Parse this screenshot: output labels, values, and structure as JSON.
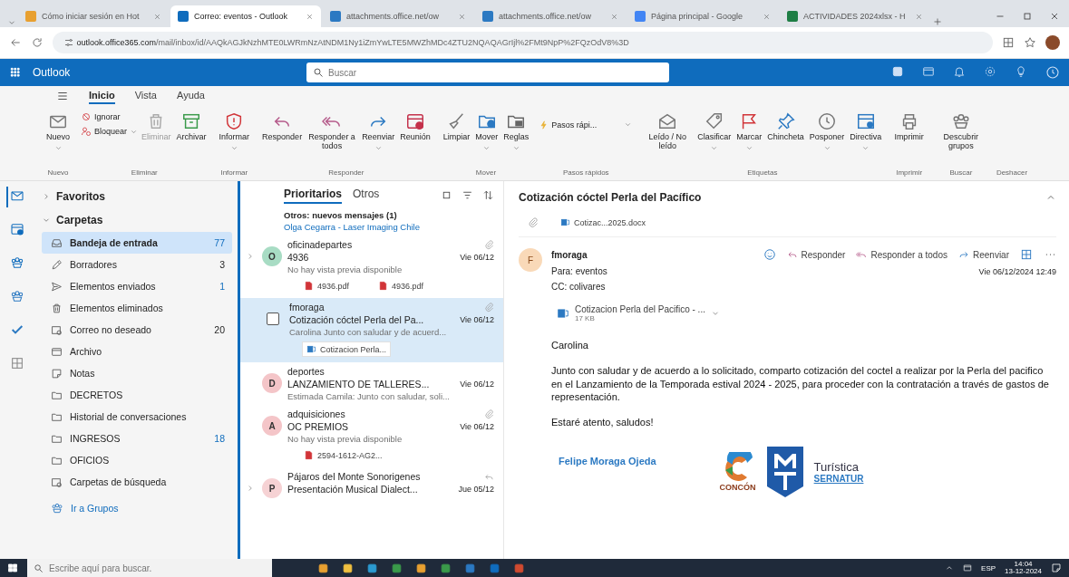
{
  "browser": {
    "tabs": [
      {
        "title": "Cómo iniciar sesión en Hot",
        "selected": false
      },
      {
        "title": "Correo: eventos - Outlook",
        "selected": true
      },
      {
        "title": "attachments.office.net/ow",
        "selected": false
      },
      {
        "title": "attachments.office.net/ow",
        "selected": false
      },
      {
        "title": "Página principal - Google",
        "selected": false
      },
      {
        "title": "ACTIVIDADES 2024xlsx - H",
        "selected": false
      }
    ],
    "url_host": "outlook.office365.com",
    "url_path": "/mail/inbox/id/AAQkAGJkNzhMTE0LWRmNzAtNDM1Ny1iZmYwLTE5MWZhMDc4ZTU2NQAQAGrIjl%2FMt9NpP%2FQzOdV8%3D"
  },
  "app_bar": {
    "title": "Outlook",
    "search": {
      "placeholder": "Buscar"
    }
  },
  "ribbon": {
    "tabs": [
      {
        "label": "Inicio",
        "selected": true
      },
      {
        "label": "Vista",
        "selected": false
      },
      {
        "label": "Ayuda",
        "selected": false
      }
    ],
    "groups": [
      {
        "label": "Nuevo",
        "buttons": [
          {
            "kind": "large",
            "label": "Nuevo",
            "dropdown": true,
            "disabled": false
          }
        ]
      },
      {
        "label": "Eliminar",
        "buttons": [
          {
            "kind": "stack",
            "items": [
              {
                "label": "Ignorar",
                "dropdown": false
              },
              {
                "label": "Bloquear",
                "dropdown": true
              }
            ]
          },
          {
            "kind": "large",
            "label": "Eliminar",
            "dropdown": false,
            "disabled": true
          },
          {
            "kind": "large",
            "label": "Archivar",
            "dropdown": false,
            "disabled": false
          }
        ]
      },
      {
        "label": "Informar",
        "buttons": [
          {
            "kind": "large",
            "label": "Informar",
            "dropdown": true,
            "disabled": false
          }
        ]
      },
      {
        "label": "Responder",
        "buttons": [
          {
            "kind": "large",
            "label": "Responder",
            "dropdown": false,
            "disabled": false
          },
          {
            "kind": "large",
            "label": "Responder a todos",
            "dropdown": false,
            "disabled": false
          },
          {
            "kind": "large",
            "label": "Reenviar",
            "dropdown": true,
            "disabled": false
          },
          {
            "kind": "large",
            "label": "Reunión",
            "dropdown": false,
            "disabled": false
          }
        ]
      },
      {
        "label": "Mover",
        "buttons": [
          {
            "kind": "large",
            "label": "Limpiar",
            "dropdown": false,
            "disabled": false
          },
          {
            "kind": "large",
            "label": "Mover",
            "dropdown": true,
            "disabled": false
          },
          {
            "kind": "large",
            "label": "Reglas",
            "dropdown": true,
            "disabled": false
          }
        ]
      },
      {
        "label": "Pasos rápidos",
        "buttons": [
          {
            "kind": "quick",
            "label": "Pasos rápi..."
          }
        ]
      },
      {
        "label": "Etiquetas",
        "buttons": [
          {
            "kind": "large",
            "label": "Leído / No leído",
            "dropdown": false,
            "disabled": false
          },
          {
            "kind": "large",
            "label": "Clasificar",
            "dropdown": true,
            "disabled": false
          },
          {
            "kind": "large",
            "label": "Marcar",
            "dropdown": true,
            "disabled": false
          },
          {
            "kind": "large",
            "label": "Chincheta",
            "dropdown": false,
            "disabled": false
          },
          {
            "kind": "large",
            "label": "Posponer",
            "dropdown": true,
            "disabled": false
          },
          {
            "kind": "large",
            "label": "Directiva",
            "dropdown": true,
            "disabled": false
          }
        ]
      },
      {
        "label": "Imprimir",
        "buttons": [
          {
            "kind": "large",
            "label": "Imprimir",
            "dropdown": false,
            "disabled": false
          }
        ]
      },
      {
        "label": "Buscar",
        "buttons": [
          {
            "kind": "large",
            "label": "Descubrir grupos",
            "dropdown": false,
            "disabled": false
          }
        ]
      },
      {
        "label": "Deshacer"
      }
    ]
  },
  "rail": [
    {
      "selected": true
    },
    {
      "selected": false
    },
    {
      "selected": false
    },
    {
      "selected": false
    },
    {
      "selected": false
    },
    {
      "selected": false
    }
  ],
  "folders": {
    "sections": [
      {
        "label": "Favoritos",
        "expanded": false
      },
      {
        "label": "Carpetas",
        "expanded": true
      }
    ],
    "items": [
      {
        "name": "Bandeja de entrada",
        "count": "77",
        "selected": true
      },
      {
        "name": "Borradores",
        "count": "3",
        "selected": false
      },
      {
        "name": "Elementos enviados",
        "count": "1",
        "selected": false
      },
      {
        "name": "Elementos eliminados",
        "selected": false
      },
      {
        "name": "Correo no deseado",
        "count": "20",
        "selected": false
      },
      {
        "name": "Archivo",
        "selected": false
      },
      {
        "name": "Notas",
        "selected": false
      },
      {
        "name": "DECRETOS",
        "selected": false
      },
      {
        "name": "Historial de conversaciones",
        "selected": false
      },
      {
        "name": "INGRESOS",
        "count": "18",
        "selected": false
      },
      {
        "name": "OFICIOS",
        "selected": false
      },
      {
        "name": "Carpetas de búsqueda",
        "selected": false
      }
    ],
    "groups_link": "Ir a Grupos"
  },
  "message_list": {
    "tabs": [
      {
        "label": "Prioritarios",
        "selected": true
      },
      {
        "label": "Otros",
        "selected": false
      }
    ],
    "notice": "Otros: nuevos mensajes (1)",
    "notice_link": "Olga Cegarra - Laser Imaging Chile",
    "messages": [
      {
        "sender": "oficinadepartes",
        "initial": "O",
        "color": "#a8dcc4",
        "subject": "4936",
        "date": "Vie 06/12",
        "preview": "No hay vista previa disponible",
        "attachments": [
          "4936.pdf",
          "4936.pdf"
        ],
        "has_attachment": true,
        "replied": false,
        "expandable": true,
        "selected": false
      },
      {
        "sender": "fmoraga",
        "subject": "Cotización cóctel Perla del Pa...",
        "date": "Vie 06/12",
        "preview": "Carolina Junto con saludar y de acuerd...",
        "attachments": [
          "Cotizacion Perla..."
        ],
        "has_attachment": true,
        "replied": false,
        "expandable": false,
        "selected": true
      },
      {
        "sender": "deportes",
        "initial": "D",
        "color": "#f4c5c8",
        "subject": "LANZAMIENTO DE TALLERES...",
        "date": "Vie 06/12",
        "preview": "Estimada Camila: Junto con saludar, soli...",
        "has_attachment": false,
        "replied": false,
        "expandable": false,
        "selected": false
      },
      {
        "sender": "adquisiciones",
        "initial": "A",
        "color": "#f4c5c8",
        "subject": "OC PREMIOS",
        "date": "Vie 06/12",
        "preview": "No hay vista previa disponible",
        "attachments": [
          "2594-1612-AG2..."
        ],
        "has_attachment": true,
        "replied": false,
        "expandable": false,
        "selected": false
      },
      {
        "sender": "Pájaros del Monte Sonorigenes",
        "initial": "P",
        "color": "#f6d2d4",
        "subject": "Presentación Musical Dialect...",
        "date": "Jue 05/12",
        "has_attachment": false,
        "replied": true,
        "expandable": true,
        "selected": false
      }
    ]
  },
  "reading_pane": {
    "subject": "Cotización cóctel Perla del Pacífico",
    "top_attachment": "Cotizac...2025.docx",
    "sender": "fmoraga",
    "initial": "F",
    "to": "Para: eventos",
    "cc": "CC: colivares",
    "date": "Vie 06/12/2024 12:49",
    "actions": [
      "Responder",
      "Responder a todos",
      "Reenviar"
    ],
    "attachment": {
      "name": "Cotizacion Perla del Pacifico - ...",
      "size": "17 KB"
    },
    "body": [
      "Carolina",
      "Junto con saludar y de acuerdo a lo solicitado, comparto cotización del coctel a realizar por la Perla del pacifico en el Lanzamiento de la Temporada estival 2024 - 2025, para proceder con la contratación a través de gastos de representación.",
      "Estaré atento, saludos!"
    ],
    "signature": {
      "name": "Felipe Moraga Ojeda",
      "logo_text": "CONCÓN",
      "brand_line": "Turística",
      "brand_sub": "SERNATUR"
    }
  },
  "taskbar": {
    "search": {
      "placeholder": "Escribe aquí para buscar."
    },
    "language": "ESP",
    "time": "14:04",
    "date": "13-12-2024"
  }
}
